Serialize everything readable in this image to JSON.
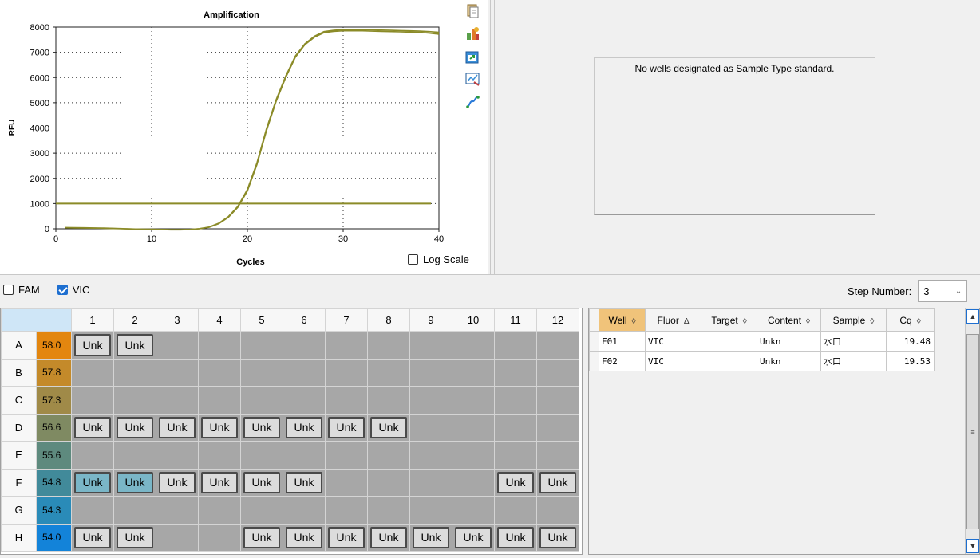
{
  "chart": {
    "title": "Amplification",
    "xlabel": "Cycles",
    "ylabel": "RFU",
    "log_scale_label": "Log Scale",
    "log_scale_checked": false
  },
  "chart_data": {
    "type": "line",
    "title": "Amplification",
    "xlabel": "Cycles",
    "ylabel": "RFU",
    "xlim": [
      0,
      40
    ],
    "ylim": [
      0,
      8000
    ],
    "x_ticks": [
      "0",
      "10",
      "20",
      "30",
      "40"
    ],
    "y_ticks": [
      "0",
      "1000",
      "2000",
      "3000",
      "4000",
      "5000",
      "6000",
      "7000",
      "8000"
    ],
    "grid": true,
    "threshold": 1000,
    "series": [
      {
        "x": [
          1,
          2,
          3,
          4,
          5,
          6,
          7,
          8,
          9,
          10,
          11,
          12,
          13,
          14,
          15,
          16,
          17,
          18,
          19,
          20,
          21,
          22,
          23,
          24,
          25,
          26,
          27,
          28,
          29,
          30,
          31,
          32,
          33,
          34,
          35,
          36,
          37,
          38,
          39,
          40
        ],
        "values": [
          40,
          35,
          30,
          25,
          20,
          10,
          0,
          -10,
          -20,
          -25,
          -30,
          -40,
          -40,
          -30,
          0,
          60,
          200,
          450,
          850,
          1500,
          2550,
          3900,
          5050,
          6000,
          6800,
          7300,
          7600,
          7780,
          7830,
          7850,
          7850,
          7850,
          7840,
          7830,
          7820,
          7810,
          7800,
          7790,
          7760,
          7720
        ],
        "color": "#8b8b28"
      },
      {
        "x": [
          1,
          2,
          3,
          4,
          5,
          6,
          7,
          8,
          9,
          10,
          11,
          12,
          13,
          14,
          15,
          16,
          17,
          18,
          19,
          20,
          21,
          22,
          23,
          24,
          25,
          26,
          27,
          28,
          29,
          30,
          31,
          32,
          33,
          34,
          35,
          36,
          37,
          38,
          39,
          40
        ],
        "values": [
          50,
          45,
          40,
          35,
          28,
          18,
          5,
          -5,
          -15,
          -20,
          -25,
          -35,
          -35,
          -25,
          5,
          70,
          220,
          480,
          890,
          1560,
          2620,
          3980,
          5120,
          6060,
          6850,
          7340,
          7640,
          7820,
          7870,
          7900,
          7900,
          7900,
          7890,
          7880,
          7870,
          7860,
          7850,
          7840,
          7820,
          7790
        ],
        "color": "#8b8b28"
      }
    ]
  },
  "toolbar_icons": [
    "copy-icon",
    "export-icon",
    "refresh-icon",
    "chart-options-icon",
    "curve-fit-icon"
  ],
  "standard_curve": {
    "message": "No wells designated as Sample Type standard."
  },
  "fluors": [
    {
      "label": "FAM",
      "checked": false
    },
    {
      "label": "VIC",
      "checked": true
    }
  ],
  "step": {
    "label": "Step Number:",
    "value": "3"
  },
  "plate": {
    "columns": [
      "1",
      "2",
      "3",
      "4",
      "5",
      "6",
      "7",
      "8",
      "9",
      "10",
      "11",
      "12"
    ],
    "rows": [
      {
        "label": "A",
        "temp": "58.0",
        "color": "#e3860f",
        "wells": [
          "Unk",
          "Unk",
          "",
          "",
          "",
          "",
          "",
          "",
          "",
          "",
          "",
          ""
        ]
      },
      {
        "label": "B",
        "temp": "57.8",
        "color": "#c48a2a",
        "wells": [
          "",
          "",
          "",
          "",
          "",
          "",
          "",
          "",
          "",
          "",
          "",
          ""
        ]
      },
      {
        "label": "C",
        "temp": "57.3",
        "color": "#a08a48",
        "wells": [
          "",
          "",
          "",
          "",
          "",
          "",
          "",
          "",
          "",
          "",
          "",
          ""
        ]
      },
      {
        "label": "D",
        "temp": "56.6",
        "color": "#7f8a62",
        "wells": [
          "Unk",
          "Unk",
          "Unk",
          "Unk",
          "Unk",
          "Unk",
          "Unk",
          "Unk",
          "",
          "",
          "",
          ""
        ]
      },
      {
        "label": "E",
        "temp": "55.6",
        "color": "#5e8a7e",
        "wells": [
          "",
          "",
          "",
          "",
          "",
          "",
          "",
          "",
          "",
          "",
          "",
          ""
        ]
      },
      {
        "label": "F",
        "temp": "54.8",
        "color": "#418a9a",
        "wells": [
          "Unk",
          "Unk",
          "Unk",
          "Unk",
          "Unk",
          "Unk",
          "",
          "",
          "",
          "",
          "Unk",
          "Unk"
        ]
      },
      {
        "label": "G",
        "temp": "54.3",
        "color": "#2a8bb8",
        "wells": [
          "",
          "",
          "",
          "",
          "",
          "",
          "",
          "",
          "",
          "",
          "",
          ""
        ]
      },
      {
        "label": "H",
        "temp": "54.0",
        "color": "#1383d9",
        "wells": [
          "Unk",
          "Unk",
          "",
          "",
          "Unk",
          "Unk",
          "Unk",
          "Unk",
          "Unk",
          "Unk",
          "Unk",
          "Unk"
        ]
      }
    ],
    "selected": [
      "F1",
      "F2"
    ]
  },
  "results": {
    "columns": [
      {
        "label": "Well",
        "sort": "◊",
        "sorted": true
      },
      {
        "label": "Fluor",
        "sort": "Δ",
        "sorted": false
      },
      {
        "label": "Target",
        "sort": "◊",
        "sorted": false
      },
      {
        "label": "Content",
        "sort": "◊",
        "sorted": false
      },
      {
        "label": "Sample",
        "sort": "◊",
        "sorted": false
      },
      {
        "label": "Cq",
        "sort": "◊",
        "sorted": false
      }
    ],
    "rows": [
      [
        "F01",
        "VIC",
        "",
        "Unkn",
        "水口",
        "19.48"
      ],
      [
        "F02",
        "VIC",
        "",
        "Unkn",
        "水口",
        "19.53"
      ]
    ]
  }
}
